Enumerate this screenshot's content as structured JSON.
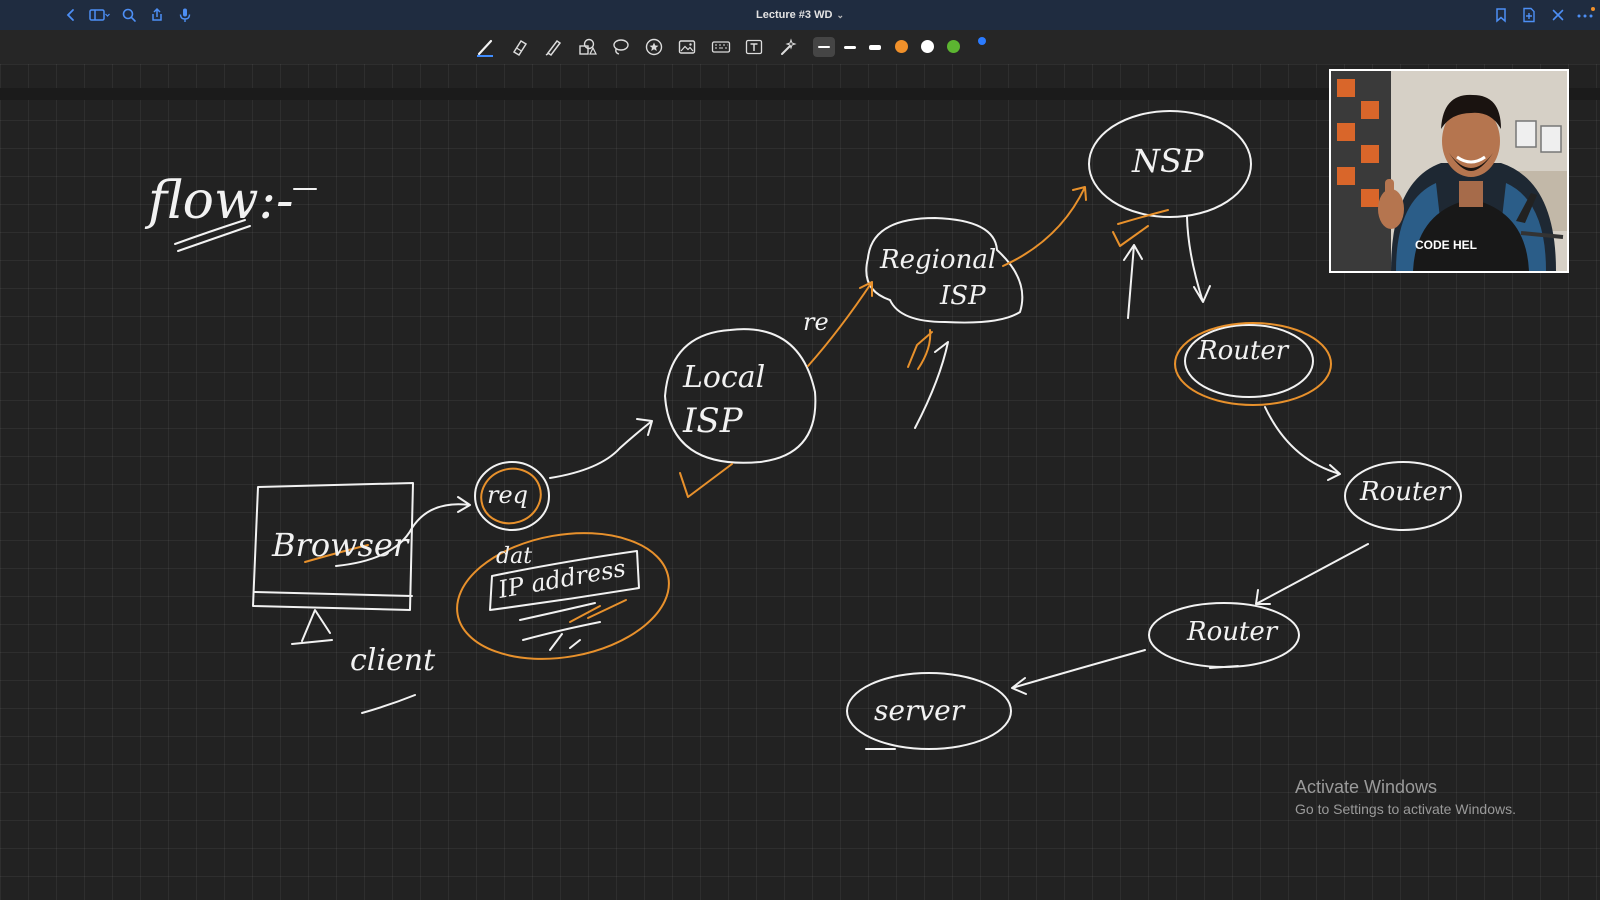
{
  "window": {
    "title": "Lecture #3 WD",
    "title_chevron": "⌄"
  },
  "toolbar": {
    "tools": [
      "pen-tool",
      "eraser-tool",
      "highlighter-tool",
      "shapes-tool",
      "lasso-tool",
      "sticker-tool",
      "image-tool",
      "keyboard-tool",
      "text-tool",
      "laser-pointer-tool"
    ],
    "thicknesses": [
      "thin",
      "medium",
      "thick"
    ],
    "colors": [
      "#f0902a",
      "#ffffff",
      "#5cb531"
    ],
    "active_color_indicator": "#2b7bff"
  },
  "sketch": {
    "heading": "flow:-",
    "labels": {
      "browser": "Browser",
      "client": "client",
      "req": "req",
      "dat": "dat",
      "ip_address": "IP address",
      "local_isp_line1": "Local",
      "local_isp_line2": "ISP",
      "re": "re",
      "regional_line1": "Regional",
      "regional_line2": "ISP",
      "nsp": "NSP",
      "router1": "Router",
      "router2": "Router",
      "router3": "Router",
      "server": "server"
    },
    "ink_color": "#f2f2f2",
    "accent_color": "#e8912c"
  },
  "webcam": {
    "shirt_text": "CODE HEL"
  },
  "watermark": {
    "line1": "Activate Windows",
    "line2": "Go to Settings to activate Windows."
  }
}
